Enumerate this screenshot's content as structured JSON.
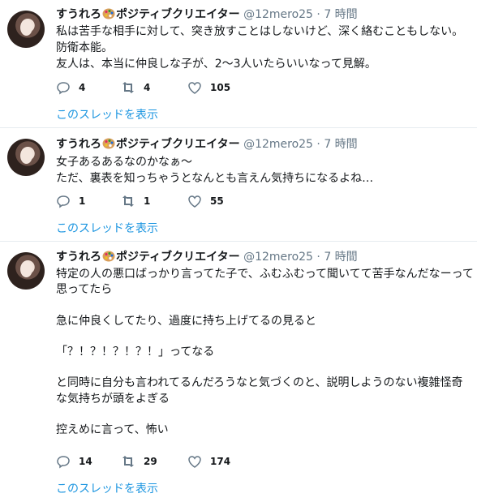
{
  "tweets": [
    {
      "name": "すうれろ",
      "name_suffix": "ポジティブクリエイター",
      "handle": "@12mero25",
      "time": "· 7 時間",
      "text": "私は苦手な相手に対して、突き放すことはしないけど、深く絡むこともしない。\n防衛本能。\n友人は、本当に仲良しな子が、2〜3人いたらいいなって見解。",
      "replies": "4",
      "retweets": "4",
      "likes": "105",
      "thread_link": "このスレッドを表示"
    },
    {
      "name": "すうれろ",
      "name_suffix": "ポジティブクリエイター",
      "handle": "@12mero25",
      "time": "· 7 時間",
      "text": "女子あるあるなのかなぁ～\nただ、裏表を知っちゃうとなんとも言えん気持ちになるよね…",
      "replies": "1",
      "retweets": "1",
      "likes": "55",
      "thread_link": "このスレッドを表示"
    },
    {
      "name": "すうれろ",
      "name_suffix": "ポジティブクリエイター",
      "handle": "@12mero25",
      "time": "· 7 時間",
      "text": "特定の人の悪口ばっかり言ってた子で、ふむふむって聞いてて苦手なんだなーって思ってたら\n\n急に仲良くしてたり、過度に持ち上げてるの見ると\n\n「？！？！？！？！」ってなる\n\nと同時に自分も言われてるんだろうなと気づくのと、説明しようのない複雑怪奇な気持ちが頭をよぎる\n\n控えめに言って、怖い",
      "replies": "14",
      "retweets": "29",
      "likes": "174",
      "thread_link": "このスレッドを表示"
    }
  ],
  "colors": {
    "link": "#1b95e0",
    "meta": "#657786",
    "text": "#14171a",
    "separator": "#e6ecf0"
  },
  "icons": [
    "avatar",
    "palette-icon",
    "reply-icon",
    "retweet-icon",
    "like-icon"
  ]
}
